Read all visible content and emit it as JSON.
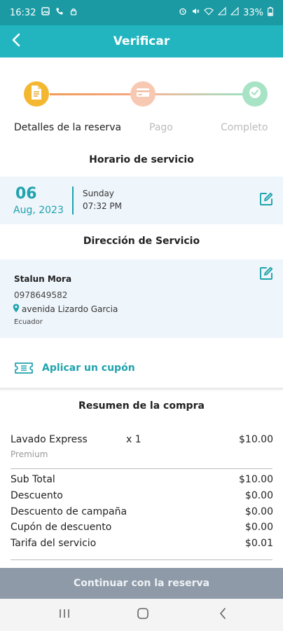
{
  "status_bar": {
    "time": "16:32",
    "battery": "33%",
    "left_icons": [
      "gallery-icon",
      "phone-icon",
      "lock-icon"
    ],
    "right_icons": [
      "alarm-icon",
      "mute-icon",
      "wifi-icon",
      "signal-icon",
      "signal-icon"
    ]
  },
  "app_bar": {
    "title": "Verificar",
    "back_icon": "chevron-left-icon"
  },
  "stepper": {
    "steps": [
      {
        "label": "Detalles de la reserva",
        "icon": "document-icon",
        "state": "active",
        "color": "#f4b731"
      },
      {
        "label": "Pago",
        "icon": "card-icon",
        "state": "pending",
        "color": "#f7c9b2"
      },
      {
        "label": "Completo",
        "icon": "check-icon",
        "state": "pending",
        "color": "#a8e3c6"
      }
    ]
  },
  "schedule": {
    "section_title": "Horario de servicio",
    "day": "06",
    "month_year": "Aug, 2023",
    "weekday": "Sunday",
    "time": "07:32 PM"
  },
  "address": {
    "section_title": "Dirección de Servicio",
    "name": "Stalun Mora",
    "phone": "0978649582",
    "street": "avenida Lizardo Garcia",
    "country": "Ecuador"
  },
  "coupon": {
    "label": "Aplicar un cupón",
    "icon": "ticket-icon"
  },
  "summary": {
    "title": "Resumen de la compra",
    "item": {
      "name": "Lavado Express",
      "sub": "Premium",
      "qty": "x 1",
      "price": "$10.00"
    },
    "rows": [
      {
        "label": "Sub Total",
        "value": "$10.00"
      },
      {
        "label": "Descuento",
        "value": "$0.00"
      },
      {
        "label": "Descuento de campaña",
        "value": "$0.00"
      },
      {
        "label": "Cupón de descuento",
        "value": "$0.00"
      },
      {
        "label": "Tarifa del servicio",
        "value": "$0.01"
      }
    ]
  },
  "cta": {
    "label": "Continuar con la reserva"
  },
  "colors": {
    "teal": "#22b5bf",
    "accent_text": "#1fa3ad",
    "card_bg": "#eef5fb",
    "cta_bg": "#8e9aa8"
  },
  "nav": {
    "icons": [
      "recents-icon",
      "home-icon",
      "back-icon"
    ]
  }
}
